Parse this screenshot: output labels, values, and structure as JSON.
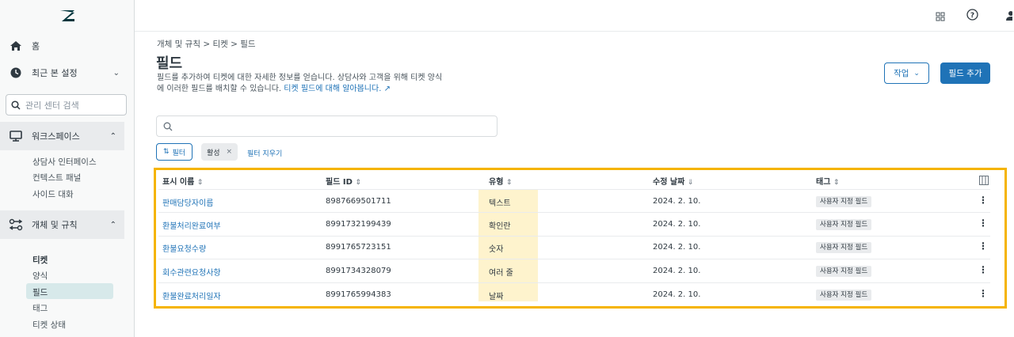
{
  "sidebar": {
    "logo_icon": "zendesk-logo-icon",
    "home_label": "홈",
    "recent_label": "최근 본 설정",
    "search_placeholder": "관리 센터 검색",
    "workspace_label": "워크스페이스",
    "workspace_items": [
      "상담사 인터페이스",
      "컨텍스트 패널",
      "사이드 대화"
    ],
    "objects_label": "개체 및 규칙",
    "tickets_header": "티켓",
    "ticket_items": [
      "양식",
      "필드",
      "태그",
      "티켓 상태"
    ],
    "selected_item": "필드"
  },
  "topbar": {
    "icons": [
      "apps-grid-icon",
      "help-icon",
      "user-icon"
    ]
  },
  "main": {
    "breadcrumb": "개체 및 규칙 > 티켓 > 필드",
    "title": "필드",
    "description_line1": "필드를 추가하여 티켓에 대한 자세한 정보를 얻습니다. 상담사와 고객을 위해 티켓 양식",
    "description_line2": "에 이러한 필드를 배치할 수 있습니다.",
    "learn_more": "티켓 필드에 대해 알아봅니다.",
    "action_button": "작업",
    "add_button": "필드 추가",
    "filter_button": "필터",
    "active_chip": "활성",
    "clear_filters": "필터 지우기"
  },
  "table": {
    "columns": {
      "name": "표시 이름",
      "id": "필드 ID",
      "type": "유형",
      "modified": "수정 날짜",
      "tags": "태그"
    },
    "rows": [
      {
        "name": "판매담당자이름",
        "id": "8987669501711",
        "type": "텍스트",
        "modified": "2024. 2. 10.",
        "tag": "사용자 지정 필드"
      },
      {
        "name": "환불처리완료여부",
        "id": "8991732199439",
        "type": "확인란",
        "modified": "2024. 2. 10.",
        "tag": "사용자 지정 필드"
      },
      {
        "name": "환불요청수량",
        "id": "8991765723151",
        "type": "숫자",
        "modified": "2024. 2. 10.",
        "tag": "사용자 지정 필드"
      },
      {
        "name": "회수관련요청사항",
        "id": "8991734328079",
        "type": "여러 줄",
        "modified": "2024. 2. 10.",
        "tag": "사용자 지정 필드"
      },
      {
        "name": "환불완료처리일자",
        "id": "8991765994383",
        "type": "날짜",
        "modified": "2024. 2. 10.",
        "tag": "사용자 지정 필드"
      }
    ]
  },
  "colors": {
    "accent": "#1f73b7",
    "highlight_frame": "#f5b400",
    "type_column_bg": "#fef3cd"
  }
}
